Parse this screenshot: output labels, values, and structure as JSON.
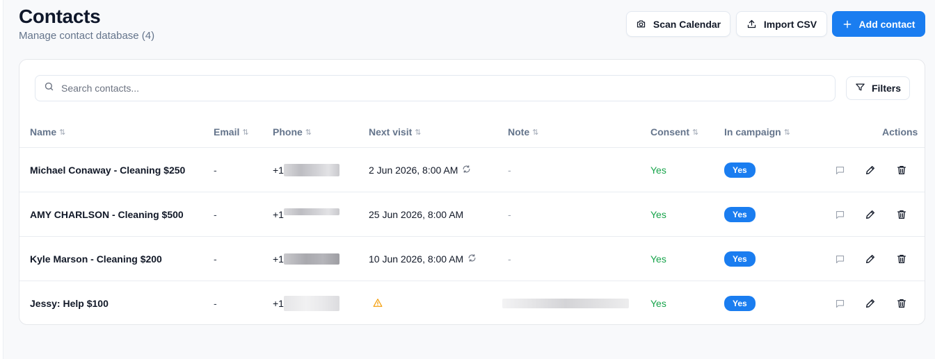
{
  "header": {
    "title": "Contacts",
    "subtitle": "Manage contact database (4)"
  },
  "toolbar": {
    "scan_label": "Scan Calendar",
    "import_label": "Import CSV",
    "add_label": "Add contact",
    "scan_icon": "camera-icon",
    "import_icon": "upload-icon",
    "add_icon": "plus-icon"
  },
  "search": {
    "placeholder": "Search contacts...",
    "value": ""
  },
  "filters_label": "Filters",
  "columns": {
    "name": "Name",
    "email": "Email",
    "phone": "Phone",
    "next_visit": "Next visit",
    "note": "Note",
    "consent": "Consent",
    "in_campaign": "In campaign",
    "actions": "Actions"
  },
  "rows": [
    {
      "name": "Michael Conaway - Cleaning $250",
      "email": "-",
      "phone_prefix": "+1",
      "next_visit": "2 Jun 2026, 8:00 AM",
      "next_visit_icon": "repeat-icon",
      "note": "-",
      "consent": "Yes",
      "in_campaign": "Yes"
    },
    {
      "name": "AMY CHARLSON - Cleaning $500",
      "email": "-",
      "phone_prefix": "+1",
      "next_visit": "25 Jun 2026, 8:00 AM",
      "next_visit_icon": "",
      "note": "-",
      "consent": "Yes",
      "in_campaign": "Yes"
    },
    {
      "name": "Kyle Marson - Cleaning $200",
      "email": "-",
      "phone_prefix": "+1",
      "next_visit": "10 Jun 2026, 8:00 AM",
      "next_visit_icon": "repeat-icon",
      "note": "-",
      "consent": "Yes",
      "in_campaign": "Yes"
    },
    {
      "name": "Jessy: Help $100",
      "email": "-",
      "phone_prefix": "+1",
      "next_visit": "",
      "next_visit_icon": "warning-icon",
      "note": "",
      "consent": "Yes",
      "in_campaign": "Yes"
    }
  ],
  "row_actions": [
    "message-icon",
    "edit-pencil-icon",
    "delete-trash-icon"
  ],
  "colors": {
    "accent": "#1a7df0",
    "consent_yes": "#16a34a",
    "warning": "#f59e0b"
  }
}
